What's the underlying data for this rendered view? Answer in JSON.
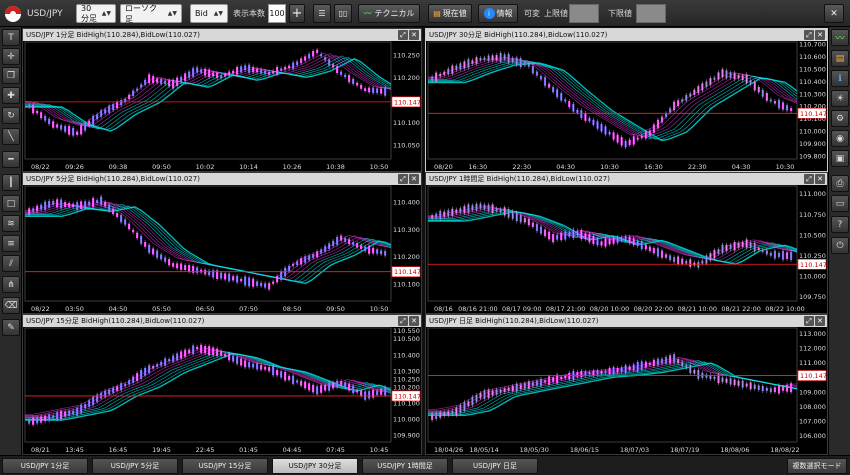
{
  "toolbar": {
    "symbol": "USD/JPY",
    "interval": "30分足",
    "chart_type": "ローソク足",
    "price_type": "Bid",
    "display_count_label": "表示本数",
    "display_count": "100",
    "technical_label": "テクニカル",
    "current_label": "現在値",
    "info_label": "情報",
    "variable_label": "可変",
    "upper_label": "上限値",
    "lower_label": "下限値"
  },
  "colors": {
    "price_line": "#ff2222",
    "band": "#00e5e5",
    "candle": "#ff3cff",
    "bg": "#000000"
  },
  "panels": [
    {
      "title": "USD/JPY 1分足  BidHigh(110.284),BidLow(110.027)",
      "price_tag": "110.147",
      "y_ticks": [
        "110.250",
        "110.200",
        "110.150",
        "110.100",
        "110.050"
      ],
      "x_ticks": [
        "08/22",
        "09:26",
        "09:38",
        "09:50",
        "10:02",
        "10:14",
        "10:26",
        "10:38",
        "10:50"
      ],
      "ylim": [
        110.02,
        110.28
      ],
      "current": 110.147,
      "active": false
    },
    {
      "title": "USD/JPY 30分足  BidHigh(110.284),BidLow(110.027)",
      "price_tag": "110.147",
      "y_ticks": [
        "110.700",
        "110.600",
        "110.500",
        "110.400",
        "110.300",
        "110.200",
        "110.100",
        "110.000",
        "109.900",
        "109.800"
      ],
      "x_ticks": [
        "08/20",
        "16:30",
        "22:30",
        "04:30",
        "10:30",
        "16:30",
        "22:30",
        "04:30",
        "10:30"
      ],
      "ylim": [
        109.78,
        110.72
      ],
      "current": 110.147,
      "active": true
    },
    {
      "title": "USD/JPY 5分足  BidHigh(110.284),BidLow(110.027)",
      "price_tag": "110.147",
      "y_ticks": [
        "110.400",
        "110.300",
        "110.200",
        "110.100"
      ],
      "x_ticks": [
        "08/22",
        "03:50",
        "04:50",
        "05:50",
        "06:50",
        "07:50",
        "08:50",
        "09:50",
        "10:50"
      ],
      "ylim": [
        110.04,
        110.46
      ],
      "current": 110.147,
      "active": false
    },
    {
      "title": "USD/JPY 1時間足  BidHigh(110.284),BidLow(110.027)",
      "price_tag": "110.147",
      "y_ticks": [
        "111.000",
        "110.750",
        "110.500",
        "110.250",
        "110.000",
        "109.750"
      ],
      "x_ticks": [
        "08/16",
        "08/16 21:00",
        "08/17 09:00",
        "08/17 21:00",
        "08/20 10:00",
        "08/20 22:00",
        "08/21 10:00",
        "08/21 22:00",
        "08/22 10:00"
      ],
      "ylim": [
        109.7,
        111.1
      ],
      "current": 110.147,
      "active": false
    },
    {
      "title": "USD/JPY 15分足  BidHigh(110.284),BidLow(110.027)",
      "price_tag": "110.147",
      "y_ticks": [
        "110.550",
        "110.500",
        "110.400",
        "110.300",
        "110.250",
        "110.200",
        "110.100",
        "110.000",
        "109.900"
      ],
      "x_ticks": [
        "08/21",
        "13:45",
        "16:45",
        "19:45",
        "22:45",
        "01:45",
        "04:45",
        "07:45",
        "10:45"
      ],
      "ylim": [
        109.86,
        110.57
      ],
      "current": 110.147,
      "active": false
    },
    {
      "title": "USD/JPY 日足  BidHigh(110.284),BidLow(110.027)",
      "price_tag": "110.147",
      "y_ticks": [
        "113.000",
        "112.000",
        "111.000",
        "110.000",
        "109.000",
        "108.000",
        "107.000",
        "106.000"
      ],
      "x_ticks": [
        "18/04/26",
        "18/05/14",
        "18/05/30",
        "18/06/15",
        "18/07/03",
        "18/07/19",
        "18/08/06",
        "18/08/22"
      ],
      "ylim": [
        105.6,
        113.4
      ],
      "current": 110.147,
      "active": false
    }
  ],
  "tabs": [
    "USD/JPY 1分足",
    "USD/JPY 5分足",
    "USD/JPY 15分足",
    "USD/JPY 30分足",
    "USD/JPY 1時間足",
    "USD/JPY 日足"
  ],
  "active_tab": 3,
  "multi_mode": "複数選択モード"
}
